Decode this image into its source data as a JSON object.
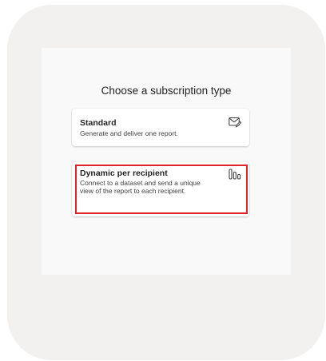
{
  "dialog": {
    "title": "Choose a subscription type"
  },
  "options": [
    {
      "title": "Standard",
      "description": "Generate and deliver one report.",
      "icon": "mail-edit-icon"
    },
    {
      "title": "Dynamic per recipient",
      "description": "Connect to a dataset and send a unique view of the report to each recipient.",
      "icon": "bar-chart-icon",
      "highlighted": true
    }
  ],
  "colors": {
    "highlight": "#e0242a",
    "frame": "#f2f1ef",
    "dialog": "#f9f9f9"
  }
}
